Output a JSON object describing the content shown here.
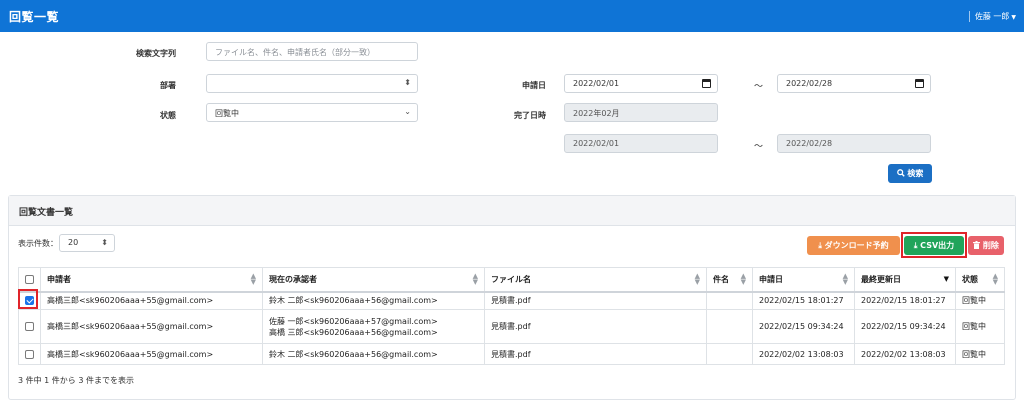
{
  "header": {
    "title": "回覧一覧",
    "user": "佐藤 一郎"
  },
  "search": {
    "keyword_label": "検索文字列",
    "keyword_placeholder": "ファイル名、件名、申請者氏名（部分一致）",
    "dept_label": "部署",
    "dept_value": "",
    "status_label": "状態",
    "status_value": "回覧中",
    "apply_date_label": "申請日",
    "apply_from": "2022/02/01",
    "apply_to": "2022/02/28",
    "complete_label": "完了日時",
    "complete_month": "2022年02月",
    "complete_from": "2022/02/01",
    "complete_to": "2022/02/28",
    "tilde": "～",
    "search_button": "検索"
  },
  "list": {
    "panel_title": "回覧文書一覧",
    "page_size_label": "表示件数：",
    "page_size_value": "20",
    "buttons": {
      "download": "ダウンロード予約",
      "csv": "CSV出力",
      "delete": "削除"
    },
    "columns": [
      "申請者",
      "現在の承認者",
      "ファイル名",
      "件名",
      "申請日",
      "最終更新日",
      "状態"
    ],
    "rows": [
      {
        "checked": true,
        "applicant": "高橋三郎<sk960206aaa+55@gmail.com>",
        "approver_1": "鈴木 二郎<sk960206aaa+56@gmail.com>",
        "approver_2": "",
        "file": "見積書.pdf",
        "subject": "",
        "applied": "2022/02/15 18:01:27",
        "updated": "2022/02/15 18:01:27",
        "status": "回覧中"
      },
      {
        "checked": false,
        "applicant": "高橋三郎<sk960206aaa+55@gmail.com>",
        "approver_1": "佐藤 一郎<sk960206aaa+57@gmail.com>",
        "approver_2": "高橋 三郎<sk960206aaa+56@gmail.com>",
        "file": "見積書.pdf",
        "subject": "",
        "applied": "2022/02/15 09:34:24",
        "updated": "2022/02/15 09:34:24",
        "status": "回覧中"
      },
      {
        "checked": false,
        "applicant": "高橋三郎<sk960206aaa+55@gmail.com>",
        "approver_1": "鈴木 二郎<sk960206aaa+56@gmail.com>",
        "approver_2": "",
        "file": "見積書.pdf",
        "subject": "",
        "applied": "2022/02/02 13:08:03",
        "updated": "2022/02/02 13:08:03",
        "status": "回覧中"
      }
    ],
    "footer": "3 件中 1 件から 3 件までを表示"
  },
  "colors": {
    "header_bg": "#0f74d6",
    "csv_button": "#20a45a",
    "download_button": "#f0904d",
    "delete_button": "#e8616a",
    "highlight": "#e0242a"
  },
  "icons": {
    "search_button": "search-icon",
    "download_button": "download-icon",
    "csv_button": "download-icon",
    "delete_button": "trash-icon"
  }
}
